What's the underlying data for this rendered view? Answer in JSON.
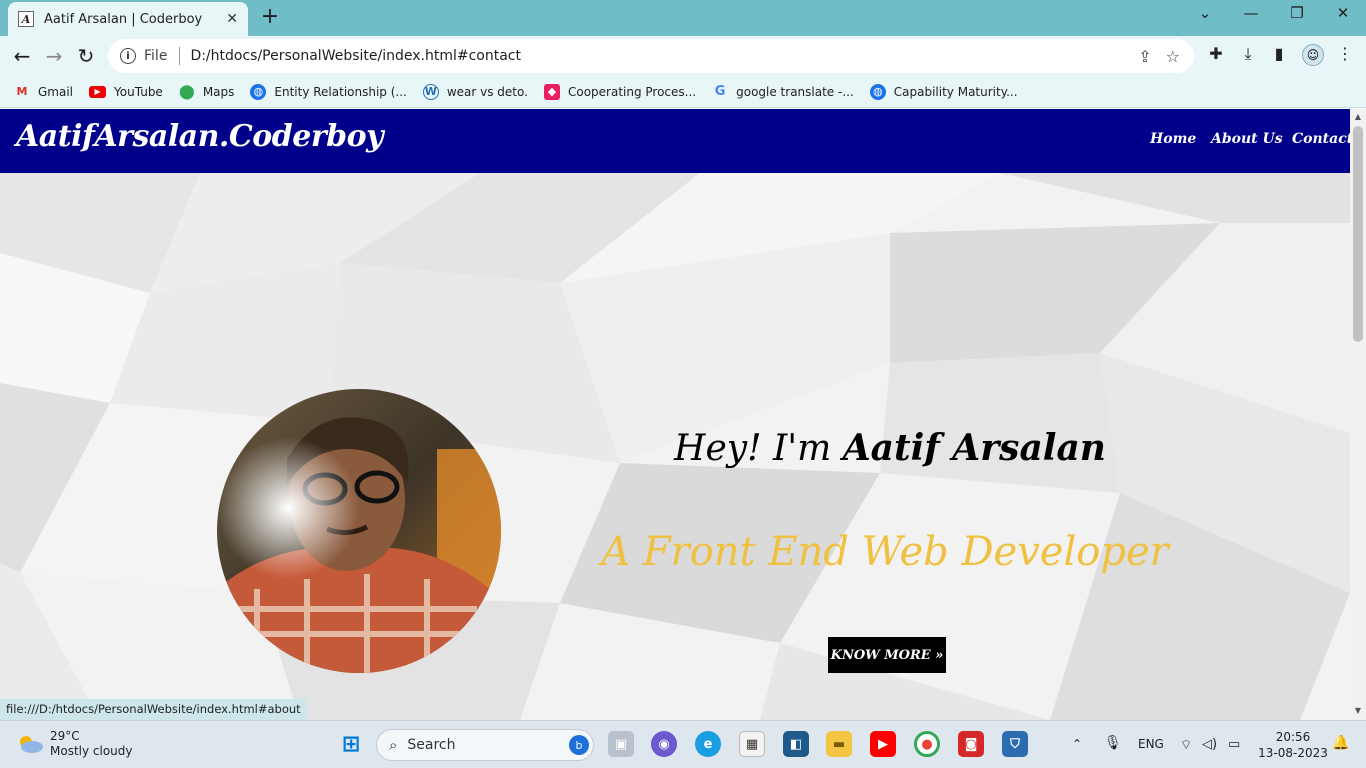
{
  "browser": {
    "tab_title": "Aatif Arsalan | Coderboy",
    "tab_favicon_letter": "A",
    "omnibox_scheme": "File",
    "url": "D:/htdocs/PersonalWebsite/index.html#contact",
    "status_url": "file:///D:/htdocs/PersonalWebsite/index.html#about",
    "bookmarks": [
      {
        "label": "Gmail",
        "icon": "gmail-icon"
      },
      {
        "label": "YouTube",
        "icon": "youtube-icon"
      },
      {
        "label": "Maps",
        "icon": "maps-icon"
      },
      {
        "label": "Entity Relationship (...",
        "icon": "globe-icon"
      },
      {
        "label": "wear vs deto.",
        "icon": "wordpress-icon"
      },
      {
        "label": "Cooperating Proces...",
        "icon": "red-cube-icon"
      },
      {
        "label": "google translate -...",
        "icon": "google-icon"
      },
      {
        "label": "Capability Maturity...",
        "icon": "globe-icon"
      }
    ]
  },
  "site": {
    "logo": "AatifArsalan.Coderboy",
    "nav": [
      "Home",
      "About Us",
      "Contact"
    ],
    "greeting_prefix": "Hey! I'm ",
    "greeting_name": "Aatif Arsalan",
    "role": "A Front End Web Developer",
    "cta": "KNOW MORE »"
  },
  "taskbar": {
    "weather_temp": "29°C",
    "weather_desc": "Mostly cloudy",
    "search_placeholder": "Search",
    "language": "ENG",
    "time": "20:56",
    "date": "13-08-2023"
  },
  "colors": {
    "site_header": "#00008b",
    "role_text": "#f0c040",
    "tabbar": "#6fbec7"
  }
}
